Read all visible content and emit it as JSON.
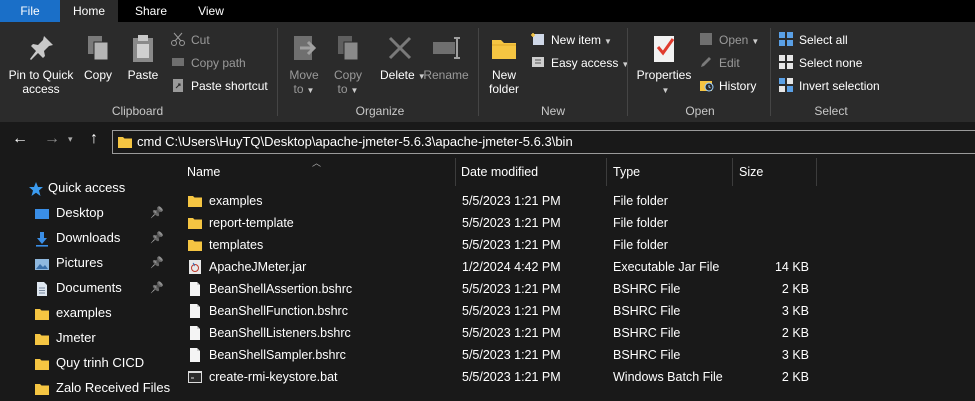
{
  "tabs": {
    "file": "File",
    "home": "Home",
    "share": "Share",
    "view": "View"
  },
  "ribbon": {
    "clipboard": {
      "label": "Clipboard",
      "pin": [
        "Pin to Quick",
        "access"
      ],
      "copy": "Copy",
      "paste": "Paste",
      "cut": "Cut",
      "copy_path": "Copy path",
      "paste_shortcut": "Paste shortcut"
    },
    "organize": {
      "label": "Organize",
      "move": [
        "Move",
        "to"
      ],
      "copy": [
        "Copy",
        "to"
      ],
      "delete": "Delete",
      "rename": "Rename"
    },
    "new": {
      "label": "New",
      "new_folder": [
        "New",
        "folder"
      ],
      "new_item": "New item",
      "easy_access": "Easy access"
    },
    "open": {
      "label": "Open",
      "properties": "Properties",
      "open": "Open",
      "edit": "Edit",
      "history": "History"
    },
    "select": {
      "label": "Select",
      "select_all": "Select all",
      "select_none": "Select none",
      "invert": "Invert selection"
    }
  },
  "address": {
    "value": "cmd C:\\Users\\HuyTQ\\Desktop\\apache-jmeter-5.6.3\\apache-jmeter-5.6.3\\bin"
  },
  "nav": [
    {
      "label": "Quick access",
      "icon": "star-icon",
      "pinned": false
    },
    {
      "label": "Desktop",
      "icon": "desktop-icon",
      "pinned": true
    },
    {
      "label": "Downloads",
      "icon": "download-icon",
      "pinned": true
    },
    {
      "label": "Pictures",
      "icon": "pictures-icon",
      "pinned": true
    },
    {
      "label": "Documents",
      "icon": "documents-icon",
      "pinned": true
    },
    {
      "label": "examples",
      "icon": "folder-icon",
      "pinned": false
    },
    {
      "label": "Jmeter",
      "icon": "folder-icon",
      "pinned": false
    },
    {
      "label": "Quy trinh CICD",
      "icon": "folder-icon",
      "pinned": false
    },
    {
      "label": "Zalo Received Files",
      "icon": "folder-icon",
      "pinned": false
    }
  ],
  "columns": {
    "name": "Name",
    "date": "Date modified",
    "type": "Type",
    "size": "Size"
  },
  "files": [
    {
      "name": "examples",
      "date": "5/5/2023 1:21 PM",
      "type": "File folder",
      "size": "",
      "icon": "folder"
    },
    {
      "name": "report-template",
      "date": "5/5/2023 1:21 PM",
      "type": "File folder",
      "size": "",
      "icon": "folder"
    },
    {
      "name": "templates",
      "date": "5/5/2023 1:21 PM",
      "type": "File folder",
      "size": "",
      "icon": "folder"
    },
    {
      "name": "ApacheJMeter.jar",
      "date": "1/2/2024 4:42 PM",
      "type": "Executable Jar File",
      "size": "14 KB",
      "icon": "jar"
    },
    {
      "name": "BeanShellAssertion.bshrc",
      "date": "5/5/2023 1:21 PM",
      "type": "BSHRC File",
      "size": "2 KB",
      "icon": "file"
    },
    {
      "name": "BeanShellFunction.bshrc",
      "date": "5/5/2023 1:21 PM",
      "type": "BSHRC File",
      "size": "3 KB",
      "icon": "file"
    },
    {
      "name": "BeanShellListeners.bshrc",
      "date": "5/5/2023 1:21 PM",
      "type": "BSHRC File",
      "size": "2 KB",
      "icon": "file"
    },
    {
      "name": "BeanShellSampler.bshrc",
      "date": "5/5/2023 1:21 PM",
      "type": "BSHRC File",
      "size": "3 KB",
      "icon": "file"
    },
    {
      "name": "create-rmi-keystore.bat",
      "date": "5/5/2023 1:21 PM",
      "type": "Windows Batch File",
      "size": "2 KB",
      "icon": "bat"
    }
  ]
}
